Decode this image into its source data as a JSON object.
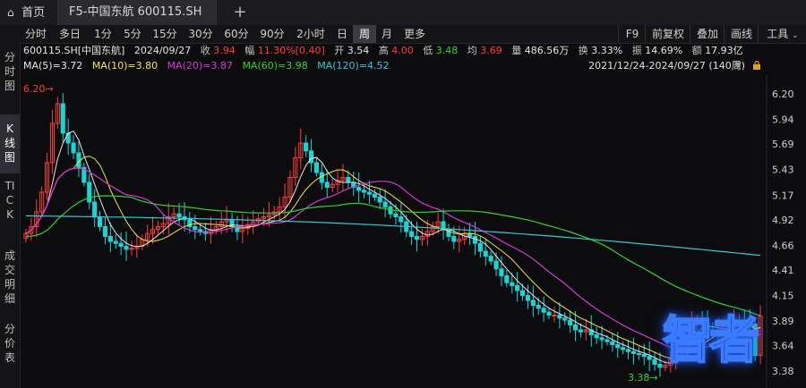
{
  "tabs": {
    "home_label": "首页",
    "stock_label": "F5-中国东航 600115.SH",
    "add_label": "+"
  },
  "toolbar": {
    "periods": [
      "分时",
      "多日",
      "1分",
      "5分",
      "15分",
      "30分",
      "60分",
      "90分",
      "2小时",
      "日",
      "周",
      "月",
      "更多"
    ],
    "active_period": "周",
    "right": [
      "F9",
      "前复权",
      "叠加",
      "画线",
      "工具"
    ]
  },
  "sidebar": {
    "items": [
      "分时图",
      "K线图",
      "TICK",
      "成交明细",
      "分价表"
    ],
    "active": "K线图"
  },
  "info": {
    "code_name": "600115.SH[中国东航]",
    "date": "2024/09/27",
    "close_label": "收",
    "close": "3.94",
    "change_label": "幅",
    "change": "11.30%[0.40]",
    "open_label": "开",
    "open": "3.54",
    "high_label": "高",
    "high": "4.00",
    "low_label": "低",
    "low": "3.48",
    "avg_label": "均",
    "avg": "3.69",
    "volume_label": "量",
    "volume": "486.56万",
    "turnover_label": "换",
    "turnover": "3.33%",
    "amplitude_label": "振",
    "amplitude": "14.69%",
    "amount_label": "额",
    "amount": "17.93亿"
  },
  "ma": {
    "ma5": "MA(5)=3.72",
    "ma10": "MA(10)=3.80",
    "ma20": "MA(20)=3.87",
    "ma60": "MA(60)=3.98",
    "ma120": "MA(120)=4.52"
  },
  "range_label": "2021/12/24-2024/09/27 (140周)",
  "watermark_text": "智者",
  "colors": {
    "up": "#ff3b3b",
    "down": "#16d6d6",
    "ma5": "#e8e8e8",
    "ma10": "#f5e24a",
    "ma20": "#d638d6",
    "ma60": "#2fd52f",
    "ma120": "#35c8d8"
  },
  "chart_data": {
    "type": "candlestick",
    "ylim": [
      3.3,
      6.3
    ],
    "yticks": [
      "6.20",
      "5.94",
      "5.69",
      "5.43",
      "5.17",
      "4.92",
      "4.66",
      "4.41",
      "4.15",
      "3.89",
      "3.64",
      "3.38"
    ],
    "annotations": {
      "high_label": "6.20",
      "low_label": "3.38"
    },
    "closes": [
      4.78,
      4.85,
      5.0,
      5.2,
      5.5,
      5.9,
      6.1,
      5.8,
      5.7,
      5.6,
      5.45,
      5.3,
      5.1,
      4.95,
      4.85,
      4.75,
      4.7,
      4.68,
      4.65,
      4.62,
      4.63,
      4.65,
      4.72,
      4.78,
      4.82,
      4.85,
      4.88,
      4.95,
      4.98,
      4.95,
      4.92,
      4.85,
      4.82,
      4.8,
      4.78,
      4.82,
      4.85,
      4.9,
      4.92,
      4.85,
      4.8,
      4.83,
      4.87,
      4.9,
      4.93,
      4.95,
      4.97,
      5.0,
      5.05,
      5.15,
      5.35,
      5.55,
      5.7,
      5.62,
      5.5,
      5.4,
      5.3,
      5.25,
      5.28,
      5.32,
      5.35,
      5.3,
      5.25,
      5.22,
      5.2,
      5.18,
      5.15,
      5.1,
      5.05,
      4.98,
      4.95,
      4.9,
      4.8,
      4.75,
      4.72,
      4.75,
      4.8,
      4.85,
      4.9,
      4.82,
      4.75,
      4.7,
      4.72,
      4.78,
      4.75,
      4.68,
      4.6,
      4.55,
      4.5,
      4.42,
      4.35,
      4.28,
      4.25,
      4.2,
      4.15,
      4.1,
      4.05,
      4.02,
      3.98,
      3.95,
      3.95,
      3.92,
      3.9,
      3.85,
      3.8,
      3.78,
      3.8,
      3.75,
      3.72,
      3.7,
      3.68,
      3.65,
      3.62,
      3.6,
      3.58,
      3.56,
      3.55,
      3.53,
      3.5,
      3.45,
      3.42,
      3.44,
      3.5,
      3.6,
      3.72,
      3.8,
      3.85,
      3.88,
      3.85,
      3.8,
      3.78,
      3.8,
      3.83,
      3.86,
      3.88,
      3.9,
      3.87,
      3.86,
      3.54,
      3.94
    ],
    "ma60_start": 4.75,
    "ma120_start": 4.96,
    "ma120_end": 4.52
  }
}
